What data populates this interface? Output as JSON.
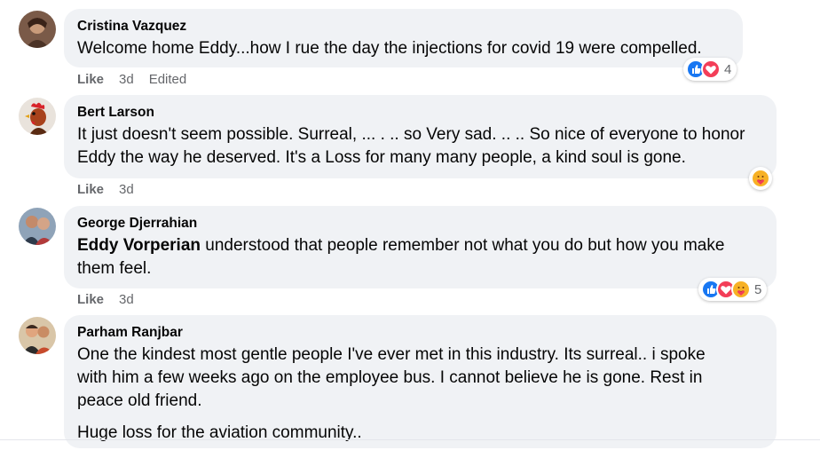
{
  "colors": {
    "like_blue": "#1877f2",
    "love_red": "#f33e58",
    "care_yellow": "#f7b125",
    "bubble_bg": "#f0f2f5",
    "meta_gray": "#65676b"
  },
  "comments": [
    {
      "author": "Cristina Vazquez",
      "text": "Welcome home Eddy...how I rue the day the injections for covid 19 were compelled.",
      "like_label": "Like",
      "time": "3d",
      "edited": "Edited",
      "reactions": [
        "like-icon",
        "love-icon"
      ],
      "reaction_count": "4"
    },
    {
      "author": "Bert Larson",
      "text_line1": "It just doesn't seem possible. Surreal, ... . .. so Very sad. .. .. So nice of everyone to honor",
      "text_line2": "Eddy the way he deserved. It's a Loss for many many people, a kind soul is gone.",
      "like_label": "Like",
      "time": "3d",
      "reactions": [
        "care-icon"
      ]
    },
    {
      "author": "George Djerrahian",
      "mention": "Eddy Vorperian",
      "text_line1": " understood that people remember not what you do but how you make",
      "text_line2": "them feel.",
      "like_label": "Like",
      "time": "3d",
      "reactions": [
        "like-icon",
        "love-icon",
        "care-icon"
      ],
      "reaction_count": "5"
    },
    {
      "author": "Parham Ranjbar",
      "text_line1": "One the kindest most gentle people I've ever met in this industry. Its surreal.. i spoke",
      "text_line2": "with him a few weeks ago on the employee bus. I cannot believe he is gone. Rest in",
      "text_line3": "peace old friend.",
      "text_line4": "Huge loss for the aviation community.."
    }
  ]
}
